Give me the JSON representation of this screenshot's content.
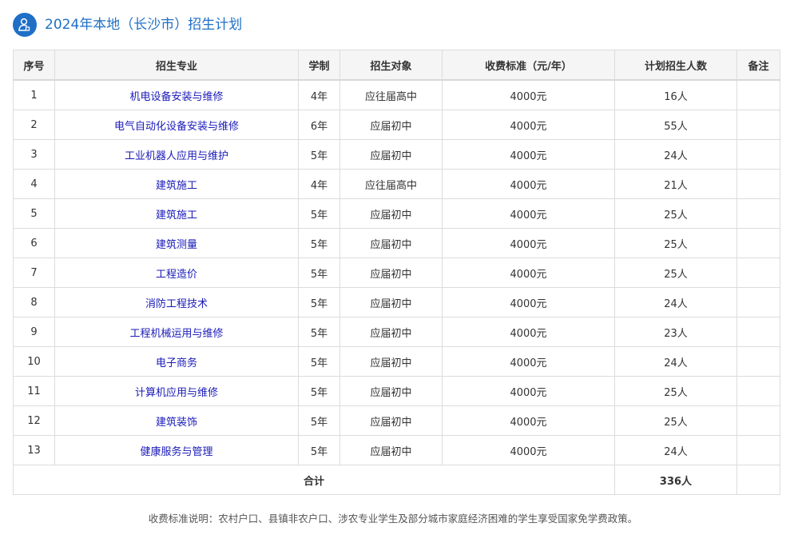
{
  "title": "2024年本地（长沙市）招生计划",
  "icon": "student-icon",
  "colors": {
    "accent": "#1f6fc6",
    "major_link": "#1a1ab8",
    "header_bg": "#f5f5f5"
  },
  "table": {
    "headers": [
      "序号",
      "招生专业",
      "学制",
      "招生对象",
      "收费标准（元/年）",
      "计划招生人数",
      "备注"
    ],
    "rows": [
      {
        "no": "1",
        "major": "机电设备安装与维修",
        "years": "4年",
        "target": "应往届高中",
        "fee": "4000元",
        "plan": "16人",
        "remark": ""
      },
      {
        "no": "2",
        "major": "电气自动化设备安装与维修",
        "years": "6年",
        "target": "应届初中",
        "fee": "4000元",
        "plan": "55人",
        "remark": ""
      },
      {
        "no": "3",
        "major": "工业机器人应用与维护",
        "years": "5年",
        "target": "应届初中",
        "fee": "4000元",
        "plan": "24人",
        "remark": ""
      },
      {
        "no": "4",
        "major": "建筑施工",
        "years": "4年",
        "target": "应往届高中",
        "fee": "4000元",
        "plan": "21人",
        "remark": ""
      },
      {
        "no": "5",
        "major": "建筑施工",
        "years": "5年",
        "target": "应届初中",
        "fee": "4000元",
        "plan": "25人",
        "remark": ""
      },
      {
        "no": "6",
        "major": "建筑测量",
        "years": "5年",
        "target": "应届初中",
        "fee": "4000元",
        "plan": "25人",
        "remark": ""
      },
      {
        "no": "7",
        "major": "工程造价",
        "years": "5年",
        "target": "应届初中",
        "fee": "4000元",
        "plan": "25人",
        "remark": ""
      },
      {
        "no": "8",
        "major": "消防工程技术",
        "years": "5年",
        "target": "应届初中",
        "fee": "4000元",
        "plan": "24人",
        "remark": ""
      },
      {
        "no": "9",
        "major": "工程机械运用与维修",
        "years": "5年",
        "target": "应届初中",
        "fee": "4000元",
        "plan": "23人",
        "remark": ""
      },
      {
        "no": "10",
        "major": "电子商务",
        "years": "5年",
        "target": "应届初中",
        "fee": "4000元",
        "plan": "24人",
        "remark": ""
      },
      {
        "no": "11",
        "major": "计算机应用与维修",
        "years": "5年",
        "target": "应届初中",
        "fee": "4000元",
        "plan": "25人",
        "remark": ""
      },
      {
        "no": "12",
        "major": "建筑装饰",
        "years": "5年",
        "target": "应届初中",
        "fee": "4000元",
        "plan": "25人",
        "remark": ""
      },
      {
        "no": "13",
        "major": "健康服务与管理",
        "years": "5年",
        "target": "应届初中",
        "fee": "4000元",
        "plan": "24人",
        "remark": ""
      }
    ],
    "total": {
      "label": "合计",
      "value": "336人"
    }
  },
  "note": "收费标准说明：农村户口、县镇非农户口、涉农专业学生及部分城市家庭经济困难的学生享受国家免学费政策。"
}
